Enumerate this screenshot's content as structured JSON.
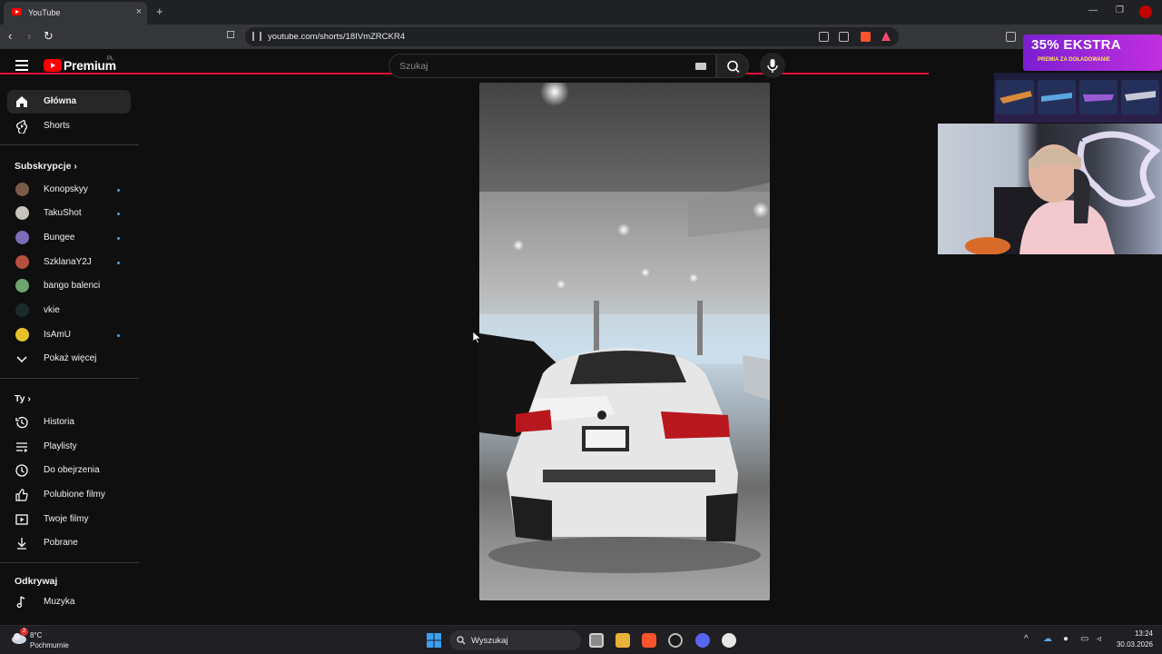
{
  "browser": {
    "tab_title": "YouTube",
    "tab_close": "×",
    "new_tab": "+",
    "url": "youtube.com/shorts/18IVmZRCKR4",
    "window_controls": [
      "—",
      "❐",
      "✕"
    ]
  },
  "masthead": {
    "logo_text": "Premium",
    "logo_region": "PL",
    "search_placeholder": "Szukaj"
  },
  "sidebar": {
    "main": [
      {
        "label": "Główna",
        "icon": "home-icon",
        "active": true
      },
      {
        "label": "Shorts",
        "icon": "shorts-icon",
        "active": false
      }
    ],
    "subscriptions_title": "Subskrypcje",
    "subscriptions": [
      {
        "label": "Konopskyy",
        "dot": true,
        "color": "#7a5a48"
      },
      {
        "label": "TakuShot",
        "dot": true,
        "color": "#c9c3bd"
      },
      {
        "label": "Bungee",
        "dot": true,
        "color": "#7d6ab8"
      },
      {
        "label": "SzklanaY2J",
        "dot": true,
        "color": "#b5503c"
      },
      {
        "label": "bango balenci",
        "dot": false,
        "color": "#6fa36f"
      },
      {
        "label": "vkie",
        "dot": false,
        "color": "#1a2a2a"
      },
      {
        "label": "IsAmU",
        "dot": true,
        "color": "#e6c22a"
      }
    ],
    "show_more": "Pokaż więcej",
    "you_title": "Ty",
    "you": [
      {
        "label": "Historia",
        "icon": "history-icon"
      },
      {
        "label": "Playlisty",
        "icon": "playlists-icon"
      },
      {
        "label": "Do obejrzenia",
        "icon": "watch-later-icon"
      },
      {
        "label": "Polubione filmy",
        "icon": "liked-icon"
      },
      {
        "label": "Twoje filmy",
        "icon": "your-videos-icon"
      },
      {
        "label": "Pobrane",
        "icon": "download-icon"
      }
    ],
    "explore_title": "Odkrywaj",
    "explore": [
      {
        "label": "Muzyka",
        "icon": "music-icon"
      }
    ]
  },
  "overlay": {
    "ad_big": "35% EKSTRA",
    "ad_small": "PREMIA ZA DOŁADOWANIE"
  },
  "taskbar": {
    "weather_temp": "8°C",
    "weather_desc": "Pochmurnie",
    "weather_badge": "2",
    "search_label": "Wyszukaj",
    "time": "13:24",
    "date": "30.03.2026"
  },
  "colors": {
    "accent": "#ff0000",
    "loading_bar": "#e3103c",
    "subscription_dot": "#3ea6ff"
  }
}
